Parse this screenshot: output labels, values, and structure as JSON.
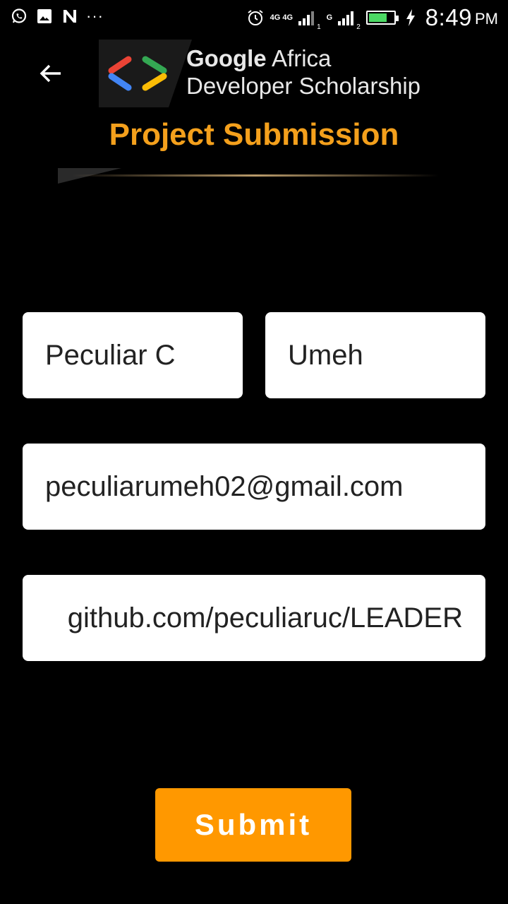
{
  "status_bar": {
    "network_1": "4G 4G",
    "sim_1": "1",
    "network_2": "G",
    "sim_2": "2",
    "time": "8:49",
    "ampm": "PM",
    "battery_percent": 75
  },
  "header": {
    "logo_line1_bold": "Google",
    "logo_line1_rest": " Africa",
    "logo_line2": "Developer Scholarship",
    "title": "Project Submission"
  },
  "form": {
    "first_name": "Peculiar C",
    "last_name": "Umeh",
    "email": "peculiarumeh02@gmail.com",
    "project_link": "github.com/peculiaruc/LEADER",
    "submit_label": "Submit"
  },
  "colors": {
    "accent": "#f4a01c",
    "button": "#ff9800",
    "background": "#000000",
    "field": "#ffffff"
  }
}
